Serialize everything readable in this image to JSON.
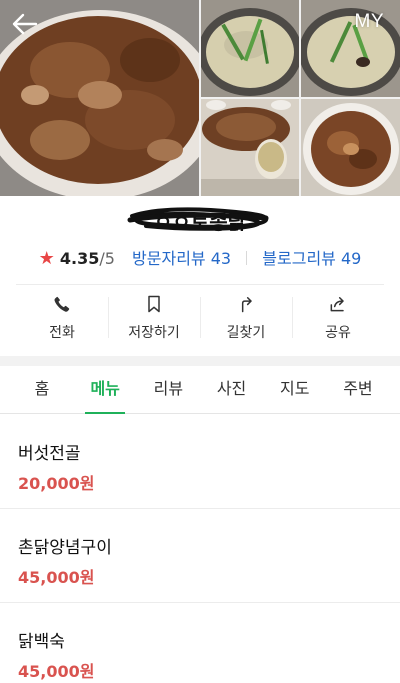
{
  "header": {
    "back_icon": "arrow-left-icon",
    "my_label": "MY"
  },
  "gallery": {
    "photos": [
      "pan-fried-chicken-dish",
      "chicken-soup-pot",
      "chicken-soup-pot-2",
      "table-spread",
      "stir-fry-plate"
    ]
  },
  "place": {
    "name": "ㅇㅇ토종닭",
    "rating_star": "★",
    "rating": "4.35",
    "rating_max": "/5",
    "visitor_reviews_label": "방문자리뷰 43",
    "blog_reviews_label": "블로그리뷰 49"
  },
  "actions": [
    {
      "icon": "phone-icon",
      "label": "전화"
    },
    {
      "icon": "bookmark-icon",
      "label": "저장하기"
    },
    {
      "icon": "directions-icon",
      "label": "길찾기"
    },
    {
      "icon": "share-icon",
      "label": "공유"
    }
  ],
  "tabs": [
    {
      "label": "홈"
    },
    {
      "label": "메뉴"
    },
    {
      "label": "리뷰"
    },
    {
      "label": "사진"
    },
    {
      "label": "지도"
    },
    {
      "label": "주변"
    }
  ],
  "active_tab": "메뉴",
  "menu": [
    {
      "name": "버섯전골",
      "price": "20,000원"
    },
    {
      "name": "촌닭양념구이",
      "price": "45,000원"
    },
    {
      "name": "닭백숙",
      "price": "45,000원"
    }
  ],
  "colors": {
    "accent_green": "#1fb15a",
    "price_red": "#d9534f",
    "link_blue": "#2468c8",
    "star_red": "#e84646"
  }
}
